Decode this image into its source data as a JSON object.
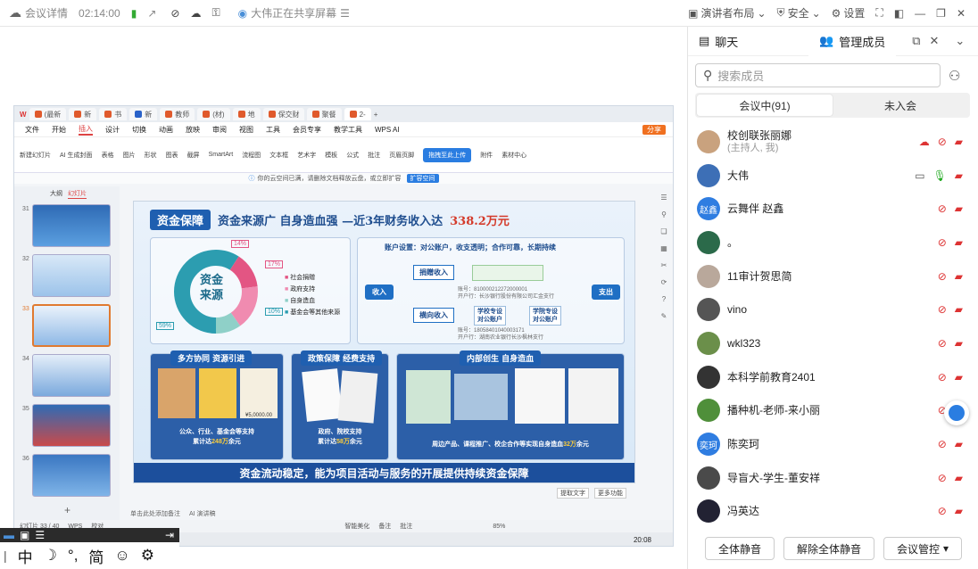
{
  "topbar": {
    "meeting_detail": "会议详情",
    "timer": "02:14:00",
    "sharing_text": "大伟正在共享屏幕",
    "layout_label": "演讲者布局",
    "security_label": "安全",
    "settings_label": "设置"
  },
  "wps": {
    "tabs": [
      "(最新",
      "新",
      "书",
      "新",
      "教师",
      "(材)",
      "地",
      "保交财",
      "聚餐",
      "2-"
    ],
    "menu": [
      "文件",
      "开始",
      "插入",
      "设计",
      "切换",
      "动画",
      "放映",
      "审阅",
      "视图",
      "工具",
      "会员专享",
      "教学工具",
      "WPS AI"
    ],
    "active_menu": "插入",
    "share_btn": "分享",
    "ribbon": [
      "新建幻灯片",
      "AI 生成封面",
      "表格",
      "图片",
      "形状",
      "图表",
      "截屏",
      "SmartArt",
      "流程图",
      "文本框",
      "艺术字",
      "模板",
      "公式",
      "批注",
      "页眉页脚",
      "附件",
      "素材中心"
    ],
    "notice": "你的云空间已满，请删除文档释放云盘，或立即扩容",
    "notice_btn": "扩容空间",
    "upload_btn": "拖拽至此上传",
    "thumb_labels": [
      "大纲",
      "幻灯片"
    ],
    "thumb_nums": [
      "31",
      "32",
      "33",
      "34",
      "35",
      "36"
    ],
    "notes_hint": "单击此处添加备注",
    "ai_note": "AI 演讲稿",
    "status_slide": "幻灯片 33 / 40",
    "status_wps": "WPS",
    "status_proof": "校对",
    "status_smart": "智能美化",
    "status_notes": "备注",
    "status_comment": "批注",
    "zoom": "85%",
    "clock": "20:08",
    "extract_text": "提取文字",
    "more": "更多功能"
  },
  "slide": {
    "tag": "资金保障",
    "headline": "资金来源广  自身造血强  —近3年财务收入达",
    "amount": "338.2万元",
    "pie_center": [
      "资金",
      "来源"
    ],
    "pie_pcts": [
      "14%",
      "17%",
      "10%",
      "59%"
    ],
    "legend": [
      "社会捐赠",
      "政府支持",
      "自身造血",
      "基金会等其他来源"
    ],
    "account_title": "账户设置：对公账户，收支透明；合作可靠，长期持续",
    "income": "收入",
    "expense": "支出",
    "donation_income": "捐赠收入",
    "horizontal_income": "横向收入",
    "school_acc": "学校专设\n对公账户",
    "college_acc": "学院专设\n对公账户",
    "acc1": "账号：810000212272000001",
    "bank1": "开户行：长沙银行股份有限公司汇金支行",
    "acc2": "账号：18058401040003171",
    "bank2": "开户行：湖南农业银行长沙枫林支行",
    "sec1_title": "多方协同 资源引进",
    "sec2_title": "政策保障 经费支持",
    "sec3_title": "内部创生 自身造血",
    "sec1_cap": "公众、行业、基金会等支持",
    "sec1_total": "累计达",
    "sec1_amt": "248万",
    "sec1_unit": "余元",
    "sec2_cap": "政府、院校支持",
    "sec2_total": "累计达",
    "sec2_amt": "58万",
    "sec2_unit": "余元",
    "sec3_cap": "周边产品、课程推广、校企合作等实现自身造血",
    "sec3_amt": "32万",
    "sec3_unit": "余元",
    "cheque": "¥5,0000.00",
    "footer": "资金流动稳定，能为项目活动与服务的开展提供持续资金保障"
  },
  "panel": {
    "tab_chat": "聊天",
    "tab_members": "管理成员",
    "search_placeholder": "搜索成员",
    "seg_in": "会议中(91)",
    "seg_out": "未入会",
    "members": [
      {
        "name": "校创联张丽娜",
        "sub": "(主持人, 我)",
        "initials": "",
        "color": "#c9a27e"
      },
      {
        "name": "大伟",
        "sub": "",
        "initials": "",
        "color": "#3d6fb6"
      },
      {
        "name": "云舞伴 赵鑫",
        "sub": "",
        "initials": "赵鑫",
        "color": "#2f7de1"
      },
      {
        "name": "。",
        "sub": "",
        "initials": "",
        "color": "#2b6a4a"
      },
      {
        "name": "11审计贺思简",
        "sub": "",
        "initials": "",
        "color": "#b9a89b"
      },
      {
        "name": "vino",
        "sub": "",
        "initials": "",
        "color": "#555"
      },
      {
        "name": "wkl323",
        "sub": "",
        "initials": "",
        "color": "#6b8f4a"
      },
      {
        "name": "本科学前教育2401",
        "sub": "",
        "initials": "",
        "color": "#333"
      },
      {
        "name": "播种机-老师-来小丽",
        "sub": "",
        "initials": "",
        "color": "#4f8f3a"
      },
      {
        "name": "陈奕珂",
        "sub": "",
        "initials": "奕珂",
        "color": "#2f7de1"
      },
      {
        "name": "导盲犬-学生-董安祥",
        "sub": "",
        "initials": "",
        "color": "#4a4a4a"
      },
      {
        "name": "冯英达",
        "sub": "",
        "initials": "",
        "color": "#223"
      }
    ],
    "btn_mute_all": "全体静音",
    "btn_unmute_all": "解除全体静音",
    "btn_control": "会议管控"
  },
  "ime": {
    "keys": [
      "中",
      "☽",
      "°,",
      "简",
      "☺",
      "⚙"
    ]
  }
}
